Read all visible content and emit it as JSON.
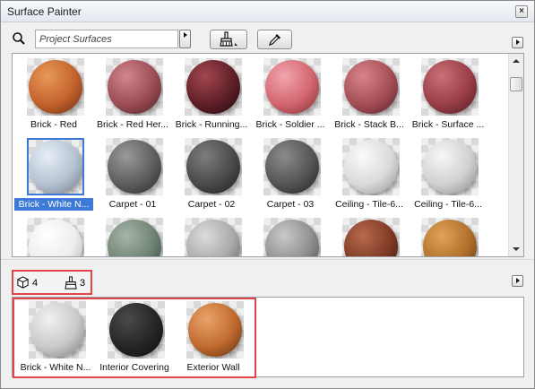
{
  "window": {
    "title": "Surface Painter",
    "close_label": "×"
  },
  "search": {
    "placeholder": "Project Surfaces",
    "value": ""
  },
  "surfaces": [
    {
      "label": "Brick - Red",
      "colors": [
        "#e89a57",
        "#c2622d",
        "#6a2b10"
      ]
    },
    {
      "label": "Brick - Red Her...",
      "colors": [
        "#d1878c",
        "#9c4c55",
        "#4e1f26"
      ]
    },
    {
      "label": "Brick - Running...",
      "colors": [
        "#a4474f",
        "#5e1f28",
        "#25080c"
      ]
    },
    {
      "label": "Brick - Soldier ...",
      "colors": [
        "#f3a5ad",
        "#d2666f",
        "#7c2b32"
      ]
    },
    {
      "label": "Brick - Stack B...",
      "colors": [
        "#d98489",
        "#a44e56",
        "#5a1f26"
      ]
    },
    {
      "label": "Brick - Surface ...",
      "colors": [
        "#c97077",
        "#9a3e47",
        "#4e1a20"
      ]
    },
    {
      "label": "Brick - White N...",
      "colors": [
        "#e6eef7",
        "#b5c2d1",
        "#6e7987"
      ],
      "selected": true
    },
    {
      "label": "Carpet - 01",
      "colors": [
        "#9a9a9a",
        "#5e5e5e",
        "#262626"
      ]
    },
    {
      "label": "Carpet - 02",
      "colors": [
        "#7d7d7d",
        "#4a4a4a",
        "#1c1c1c"
      ]
    },
    {
      "label": "Carpet - 03",
      "colors": [
        "#8b8b8b",
        "#555555",
        "#202020"
      ]
    },
    {
      "label": "Ceiling - Tile-6...",
      "colors": [
        "#fbfbfb",
        "#dadada",
        "#8f8f8f"
      ]
    },
    {
      "label": "Ceiling - Tile-6...",
      "colors": [
        "#f7f7f7",
        "#d1d1d1",
        "#878787"
      ]
    },
    {
      "label": "",
      "colors": [
        "#ffffff",
        "#ededed",
        "#a8a8a8"
      ]
    },
    {
      "label": "",
      "colors": [
        "#a6b5a9",
        "#6f8273",
        "#34403a"
      ]
    },
    {
      "label": "",
      "colors": [
        "#dcdcdc",
        "#a9a9a9",
        "#5e5e5e"
      ]
    },
    {
      "label": "",
      "colors": [
        "#c9c9c9",
        "#8e8e8e",
        "#494949"
      ]
    },
    {
      "label": "",
      "colors": [
        "#b86a4d",
        "#7f3a25",
        "#3a170c"
      ]
    },
    {
      "label": "",
      "colors": [
        "#e2a358",
        "#b06f2b",
        "#5a3510"
      ]
    }
  ],
  "status": {
    "object_count": "4",
    "surface_count": "3"
  },
  "used_surfaces": [
    {
      "label": "Brick - White N...",
      "colors": [
        "#f1f1f1",
        "#c9c9c9",
        "#7c7c7c"
      ]
    },
    {
      "label": "Interior Covering",
      "colors": [
        "#4a4a4a",
        "#262626",
        "#0b0b0b"
      ]
    },
    {
      "label": "Exterior Wall",
      "colors": [
        "#e9a46a",
        "#c06a2e",
        "#5a2c0e"
      ]
    }
  ],
  "icons": {
    "search": "search-icon",
    "brush": "paintbrush-icon",
    "picker": "eyedropper-icon",
    "objects": "cube-icon",
    "surfaces": "paintbrush-icon"
  },
  "accent": {
    "selection": "#3d7ad8",
    "highlight": "#e0454a"
  }
}
